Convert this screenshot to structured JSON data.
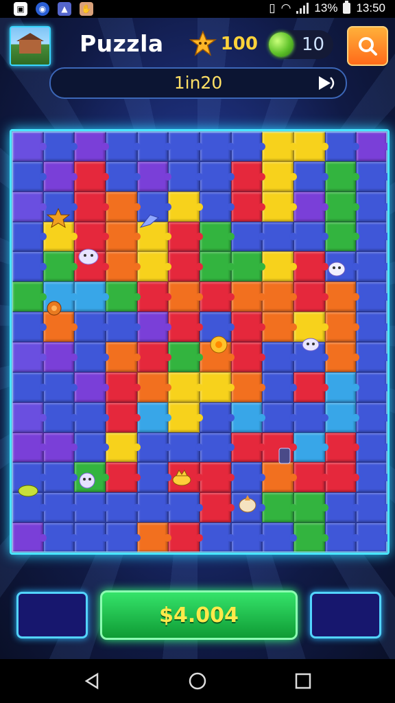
{
  "status_bar": {
    "battery": "13%",
    "time": "13:50"
  },
  "header": {
    "title": "Puzzla",
    "coins": "100",
    "gems": "10",
    "level": "1in20"
  },
  "controls": {
    "main_label": "$4.004"
  },
  "colors": {
    "accent_glow": "#49e6ff",
    "coin": "#ffd23a",
    "main_button": "#1fc24e"
  },
  "board": {
    "columns": 12,
    "rows": 14,
    "pieces": [
      "p",
      "b",
      "v",
      "b",
      "b",
      "b",
      "b",
      "b",
      "y",
      "y",
      "b",
      "v",
      "b",
      "v",
      "r",
      "b",
      "v",
      "b",
      "b",
      "r",
      "y",
      "b",
      "g",
      "b",
      "p",
      "b",
      "r",
      "o",
      "b",
      "y",
      "b",
      "r",
      "y",
      "v",
      "g",
      "b",
      "b",
      "y",
      "r",
      "o",
      "y",
      "r",
      "g",
      "b",
      "b",
      "b",
      "g",
      "b",
      "b",
      "g",
      "r",
      "o",
      "y",
      "r",
      "g",
      "g",
      "y",
      "r",
      "b",
      "b",
      "g",
      "c",
      "c",
      "g",
      "r",
      "o",
      "r",
      "o",
      "o",
      "r",
      "o",
      "b",
      "b",
      "o",
      "b",
      "b",
      "v",
      "r",
      "b",
      "r",
      "o",
      "y",
      "o",
      "b",
      "p",
      "v",
      "b",
      "o",
      "r",
      "g",
      "o",
      "r",
      "b",
      "b",
      "o",
      "b",
      "b",
      "b",
      "v",
      "r",
      "o",
      "y",
      "y",
      "o",
      "b",
      "r",
      "c",
      "b",
      "p",
      "b",
      "b",
      "r",
      "c",
      "y",
      "b",
      "c",
      "b",
      "b",
      "c",
      "b",
      "v",
      "v",
      "b",
      "y",
      "b",
      "b",
      "b",
      "r",
      "r",
      "c",
      "r",
      "b",
      "b",
      "b",
      "g",
      "r",
      "b",
      "r",
      "r",
      "b",
      "o",
      "r",
      "r",
      "b",
      "b",
      "b",
      "b",
      "b",
      "b",
      "b",
      "r",
      "b",
      "g",
      "g",
      "b",
      "b",
      "v",
      "b",
      "b",
      "b",
      "o",
      "r",
      "b",
      "b",
      "b",
      "g",
      "b",
      "b"
    ]
  }
}
